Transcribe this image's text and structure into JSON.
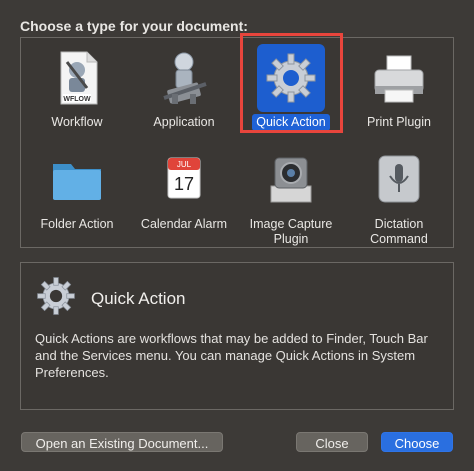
{
  "dialog": {
    "heading": "Choose a type for your document:"
  },
  "types": [
    {
      "label": "Workflow",
      "icon": "workflow-document-icon"
    },
    {
      "label": "Application",
      "icon": "automator-robot-icon"
    },
    {
      "label": "Quick Action",
      "icon": "gear-icon",
      "selected": true
    },
    {
      "label": "Print Plugin",
      "icon": "printer-icon"
    },
    {
      "label": "Folder Action",
      "icon": "folder-icon"
    },
    {
      "label": "Calendar Alarm",
      "icon": "calendar-icon"
    },
    {
      "label": "Image Capture\nPlugin",
      "icon": "camera-icon"
    },
    {
      "label": "Dictation\nCommand",
      "icon": "microphone-icon"
    }
  ],
  "icon_text": {
    "workflow_tag": "WFLOW",
    "calendar_month": "JUL",
    "calendar_day": "17"
  },
  "description": {
    "title": "Quick Action",
    "text": "Quick Actions are workflows that may be added to Finder, Touch Bar and the Services menu. You can manage Quick Actions in System Preferences."
  },
  "buttons": {
    "open_existing": "Open an Existing Document...",
    "close": "Close",
    "choose": "Choose"
  },
  "colors": {
    "selection_blue": "#1f62d6",
    "highlight_outline": "#e8453c"
  }
}
